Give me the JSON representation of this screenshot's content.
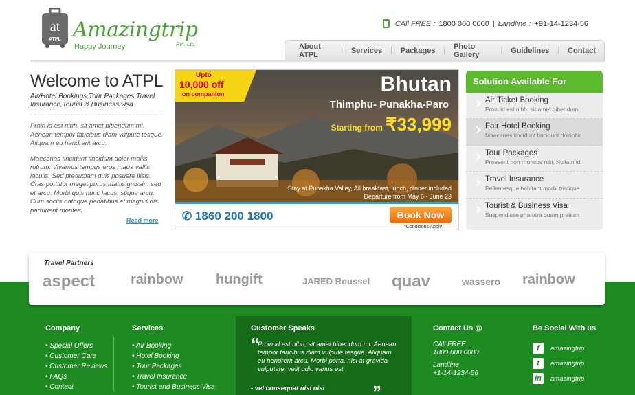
{
  "header": {
    "brand": "Amazingtrip",
    "logo_initials": "at",
    "logo_sub": "ATPL",
    "tagline": "Happy Journey",
    "pvt": "Pvt. Ltd.",
    "call_label": "CAll FREE :",
    "call_number": "1800 000 0000",
    "landline_label": "Landline :",
    "landline_number": "+91-14-1234-56"
  },
  "nav": [
    "About ATPL",
    "Services",
    "Packages",
    "Photo Gallery",
    "Guidelines",
    "Contact"
  ],
  "welcome": {
    "title": "Welcome to ATPL",
    "subtitle": "Air/Hotel Bookings,Tour Packages,Travel Insurance,Tourist & Business visa",
    "para1": "Proin id est nibh, sit amet bibendum mi. Aenean tempor faucibus diam vulpute tesque. Aliquam eu hendrerit arcu.",
    "para2": "Maecenas tincidunt tincidunt dolor mollis rutrum. Vivamus tempus eros maga vallis iaculis. Sed pretiudiam quis posuere ilisis. Cras porttitor meget purus mattisignissim sed et arcu. Morbi quis nunc lacus, stique arcu. Cum sociis natoque penatibus et magnis dis parturient montes.",
    "read_more": "Read more"
  },
  "banner": {
    "promo_upto": "Upto",
    "promo_amount": "10,000 off",
    "promo_on": "on companion",
    "destination": "Bhutan",
    "route": "Thimphu- Punakha-Paro",
    "starting_label": "Starting from",
    "price": "₹33,999",
    "stay": "Stay at Punakha Valley, All breakfast, lunch, dinner included",
    "departure": "Departure from  May 6 - June 23",
    "phone": "1860 200 1800",
    "book_label": "Book Now",
    "conditions": "*Conditions Apply"
  },
  "solutions": {
    "title": "Solution Available For",
    "items": [
      {
        "title": "Air Ticket Booking",
        "desc": "Proin id est nibh, sit amet bibendum"
      },
      {
        "title": "Fair Hotel Booking",
        "desc": "Maecenas tincidunt tincidunt doloollis"
      },
      {
        "title": "Tour Packages",
        "desc": "Praesent non rhoncus nisi. Nullam id"
      },
      {
        "title": "Travel Insurance",
        "desc": "Pellentesque habitant morbi tristique"
      },
      {
        "title": "Tourist & Business Visa",
        "desc": "Suspendisse pharetra quam pretium"
      }
    ]
  },
  "partners": {
    "title": "Travel Partners",
    "logos": [
      "aspect",
      "rainbow",
      "hungift",
      "JARED Roussel",
      "quav",
      "wassero",
      "rainbow"
    ]
  },
  "footer": {
    "company": {
      "title": "Company",
      "items": [
        "Special Offers",
        "Customer Care",
        "Customer Reviews",
        "FAQs",
        "Contact"
      ]
    },
    "services": {
      "title": "Services",
      "items": [
        "Air Booking",
        "Hotel Booking",
        "Tour Packages",
        "Travel  Insurance",
        "Tourist and Business Visa"
      ]
    },
    "customer": {
      "title": "Customer Speaks",
      "quote": "Proin id est nibh, sit amet bibendum mi. Aenean tempor faucibus diam vulpute tesque. Aliquam eu hendrerit arcu. Morbi porta, nisi at gravida vulputate, velit odio varius est,",
      "by": "- vel consequat nisi nisl"
    },
    "contact": {
      "title": "Contact Us @",
      "call_label": "CAll FREE",
      "call_number": "1800 000 0000",
      "landline_label": "Landline",
      "landline_number": "+1-14-1234-56"
    },
    "social": {
      "title": "Be Social With us",
      "items": [
        "amazingtrip",
        "amazingtrip",
        "amazingtrip"
      ]
    }
  }
}
